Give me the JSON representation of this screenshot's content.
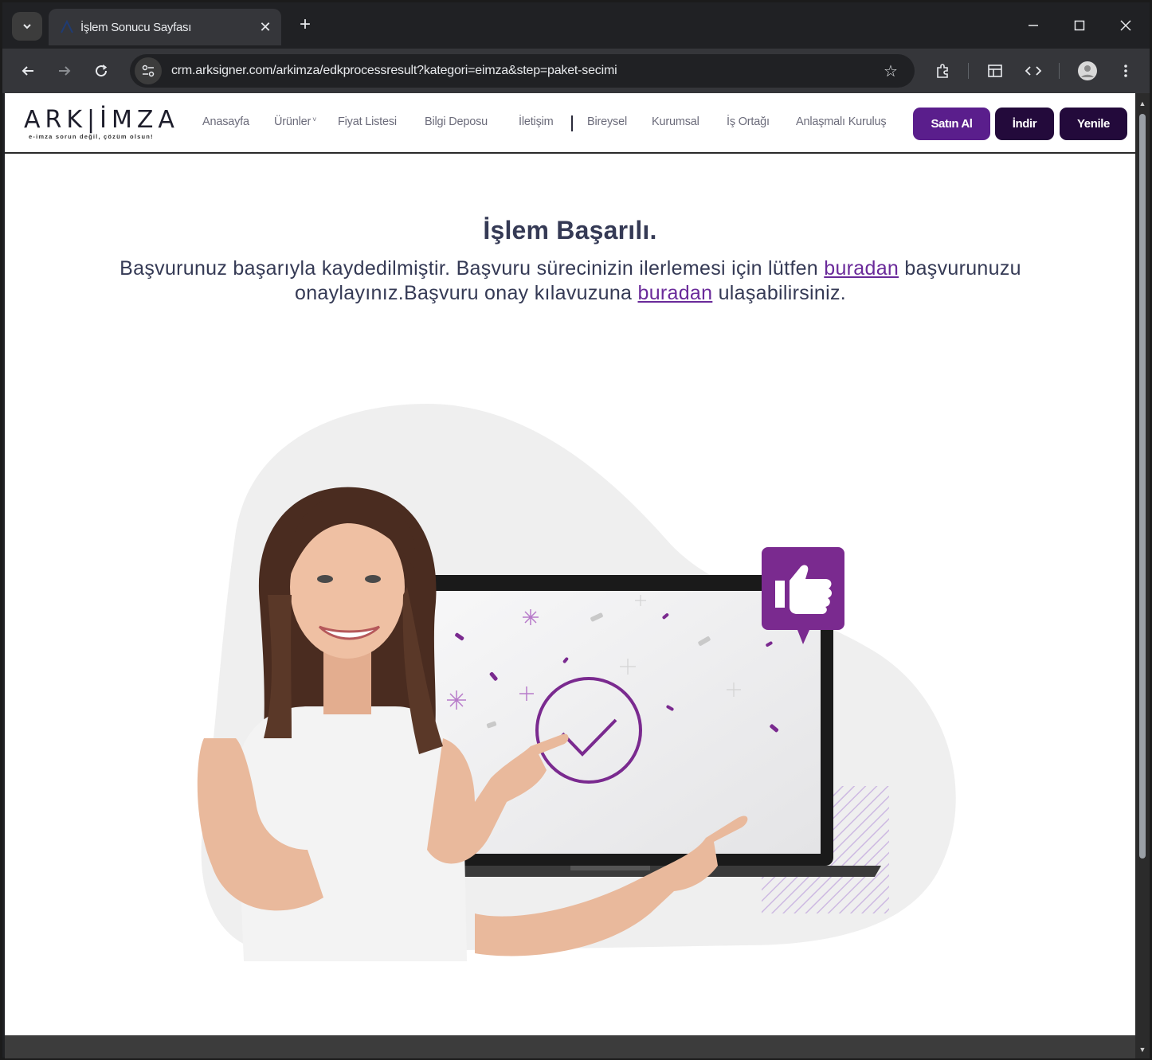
{
  "browser": {
    "tab_title": "İşlem Sonucu Sayfası",
    "url": "crm.arksigner.com/arkimza/edkprocessresult?kategori=eimza&step=paket-secimi"
  },
  "site": {
    "logo_text": "ARK|İMZA",
    "logo_tagline": "e-imza sorun değil, çözüm olsun!",
    "nav": [
      {
        "label": "Anasayfa"
      },
      {
        "label": "Ürünler"
      },
      {
        "label": "Fiyat Listesi"
      },
      {
        "label": "Bilgi Deposu"
      },
      {
        "label": "İletişim"
      },
      {
        "label": "Bireysel"
      },
      {
        "label": "Kurumsal"
      },
      {
        "label": "İş Ortağı"
      },
      {
        "label": "Anlaşmalı Kuruluş"
      }
    ],
    "buttons": {
      "buy": "Satın Al",
      "download": "İndir",
      "renew": "Yenile"
    },
    "colors": {
      "primary_purple": "#5a1e8c",
      "dark_purple": "#230a3b",
      "text": "#353a55",
      "link": "#6a2a9a"
    }
  },
  "content": {
    "title": "İşlem Başarılı.",
    "message_part1": "Başvurunuz başarıyla kaydedilmiştir. Başvuru sürecinizin ilerlemesi için lütfen ",
    "link1": "buradan",
    "message_part2": " başvurunuzu onaylayınız.Başvuru onay kılavuzuna ",
    "link2": "buradan",
    "message_part3": " ulaşabilirsiniz."
  }
}
